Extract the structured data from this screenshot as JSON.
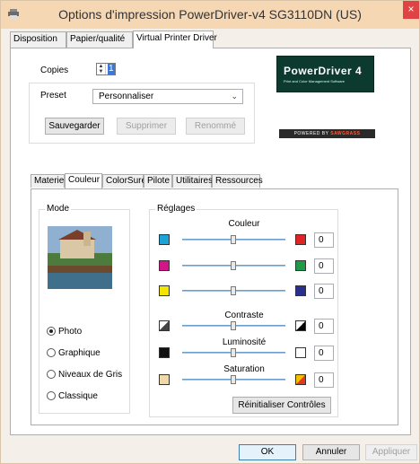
{
  "window": {
    "title": "Options d'impression PowerDriver-v4 SG3110DN (US)",
    "close_glyph": "×",
    "title_bg": "#f6d7b4",
    "close_bg": "#e04343"
  },
  "top_tabs": [
    "Disposition",
    "Papier/qualité",
    "Virtual Printer Driver"
  ],
  "copies": {
    "label": "Copies",
    "value": "1"
  },
  "preset": {
    "label": "Preset",
    "selected": "Personnaliser",
    "buttons": {
      "save": "Sauvegarder",
      "delete": "Supprimer",
      "rename": "Renommé"
    }
  },
  "logos": {
    "powerdriver": "PowerDriver 4",
    "powerdriver_sub": "Print and Color Management Software",
    "sawgrass": "POWERED BY",
    "sawgrass_brand": "SAWGRASS"
  },
  "inner_tabs": [
    "Materiel",
    "Couleur",
    "ColorSure",
    "Pilote",
    "Utilitaires",
    "Ressources"
  ],
  "mode": {
    "title": "Mode",
    "options": [
      "Photo",
      "Graphique",
      "Niveaux de Gris",
      "Classique"
    ],
    "selected": "Photo"
  },
  "reglages": {
    "title": "Réglages",
    "couleur_title": "Couleur",
    "color_sliders": [
      {
        "left_color": "#1aa3d9",
        "right_color": "#e02424",
        "value": "0"
      },
      {
        "left_color": "#d6148a",
        "right_color": "#1f9a48",
        "value": "0"
      },
      {
        "left_color": "#f2e600",
        "right_color": "#2a2e8c",
        "value": "0"
      }
    ],
    "contraste_title": "Contraste",
    "contraste_value": "0",
    "luminosite_title": "Luminosité",
    "luminosite_value": "0",
    "saturation_title": "Saturation",
    "saturation_value": "0",
    "reset_button": "Réinitialiser Contrôles"
  },
  "dialog_buttons": {
    "ok": "OK",
    "cancel": "Annuler",
    "apply": "Appliquer"
  }
}
